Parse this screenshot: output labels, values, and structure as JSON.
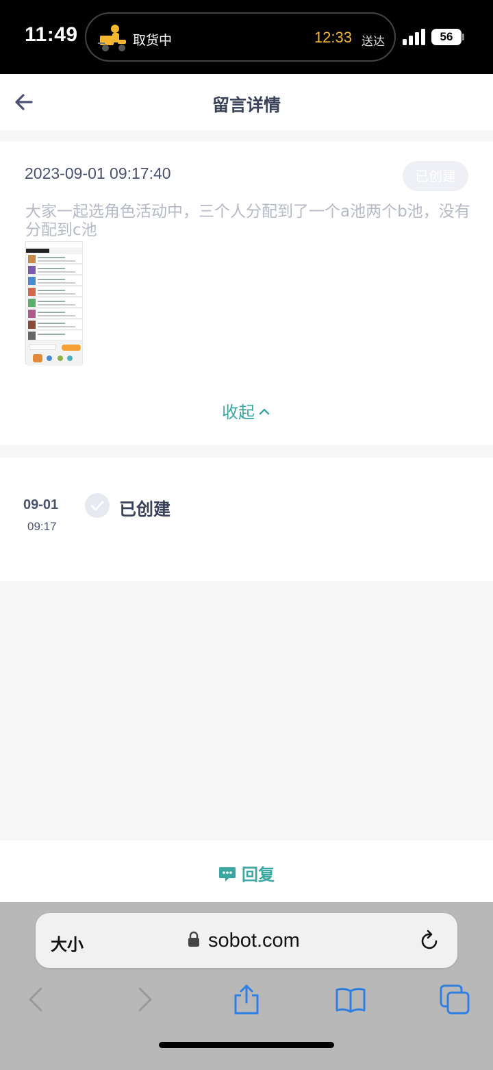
{
  "status_bar": {
    "time": "11:49",
    "activity_label": "取货中",
    "eta_time": "12:33",
    "eta_suffix": "送达",
    "battery": "56"
  },
  "header": {
    "title": "留言详情",
    "back_icon": "arrow-left-icon"
  },
  "message": {
    "date": "2023-09-01 09:17:40",
    "status_badge": "已创建",
    "text": "大家一起选角色活动中，三个人分配到了一个a池两个b池，没有分配到c池",
    "collapse_label": "收起",
    "attachment_icon": "screenshot-thumbnail"
  },
  "timeline": [
    {
      "date": "09-01",
      "time": "09:17",
      "status": "已创建"
    }
  ],
  "reply": {
    "label": "回复",
    "icon": "chat-bubble-icon"
  },
  "browser": {
    "text_size_label": "大小",
    "url": "sobot.com",
    "toolbar_icons": [
      "back-icon",
      "forward-icon",
      "share-icon",
      "bookmarks-icon",
      "tabs-icon"
    ]
  },
  "colors": {
    "accent": "#3aa7a0",
    "title_text": "#3a4259",
    "eta": "#f5b731"
  }
}
